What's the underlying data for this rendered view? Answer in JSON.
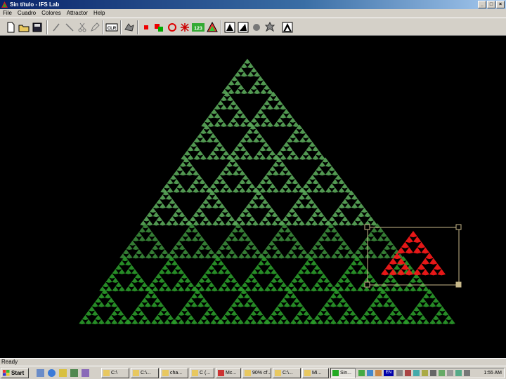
{
  "window": {
    "title": "Sin título - IFS Lab"
  },
  "menu": [
    "File",
    "Cuadro",
    "Colores",
    "Attractor",
    "Help"
  ],
  "window_controls": [
    "minimize-icon",
    "maximize-icon",
    "close-icon"
  ],
  "toolbar": [
    {
      "icon": "new-file-icon",
      "interactable": true
    },
    {
      "icon": "open-folder-icon",
      "interactable": true
    },
    {
      "icon": "save-icon",
      "interactable": true
    },
    {
      "icon": "line-tool-icon",
      "interactable": true
    },
    {
      "icon": "diagonal-tool-icon",
      "interactable": true
    },
    {
      "icon": "scissors-icon",
      "interactable": true
    },
    {
      "icon": "pencil-icon",
      "interactable": true
    },
    {
      "icon": "clear-button",
      "label": "CLR",
      "interactable": true
    },
    {
      "icon": "settings-icon",
      "interactable": true
    },
    {
      "icon": "red-square-icon",
      "interactable": true
    },
    {
      "icon": "color-squares-icon",
      "interactable": true
    },
    {
      "icon": "rotate-icon",
      "interactable": true
    },
    {
      "icon": "bug-icon",
      "interactable": true
    },
    {
      "icon": "numbers-button",
      "label": "123",
      "interactable": true
    },
    {
      "icon": "palette-icon",
      "interactable": true
    },
    {
      "icon": "render-icon",
      "interactable": true
    },
    {
      "icon": "render-alt-icon",
      "interactable": true
    },
    {
      "icon": "sphere-icon",
      "interactable": true
    },
    {
      "icon": "gear-icon",
      "interactable": true
    },
    {
      "icon": "attractor-icon",
      "interactable": true
    }
  ],
  "colors": {
    "fractal": "#2a9a2a",
    "highlight": "#ff1a1a",
    "background": "#000000",
    "selection": "#c8b98a"
  },
  "status": {
    "text": "Ready"
  },
  "taskbar": {
    "start_label": "Start",
    "quick_launch": [
      "desktop-icon",
      "ie-icon",
      "outlook-icon",
      "media-icon"
    ],
    "tasks": [
      {
        "label": "C:\\",
        "active": false
      },
      {
        "label": "C:\\...",
        "active": false
      },
      {
        "label": "cha...",
        "active": false
      },
      {
        "label": "C (...",
        "active": false
      },
      {
        "label": "Mc...",
        "active": false
      },
      {
        "label": "90% cf...",
        "active": false
      },
      {
        "label": "C:\\...",
        "active": false
      },
      {
        "label": "Mi...",
        "active": false
      },
      {
        "label": "Sin...",
        "active": true
      }
    ],
    "tray_language": "EN",
    "clock": "1:55 AM"
  }
}
